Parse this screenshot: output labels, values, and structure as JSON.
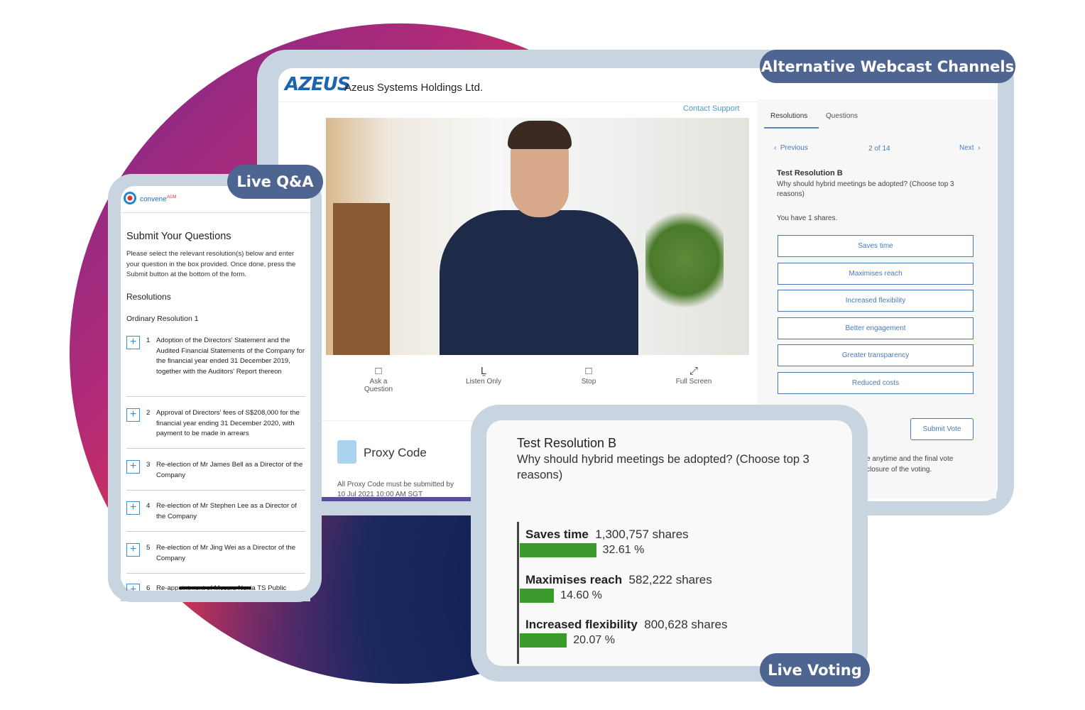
{
  "badges": {
    "webcast": "Alternative Webcast Channels",
    "qa": "Live Q&A",
    "voting": "Live Voting"
  },
  "webcast": {
    "logo_text": "AZEUS",
    "company": "Azeus Systems Holdings Ltd.",
    "contact": "Contact Support",
    "controls": [
      {
        "icon": "ask-question-icon",
        "label": "Ask a Question"
      },
      {
        "icon": "headphones-icon",
        "label": "Listen Only"
      },
      {
        "icon": "stop-icon",
        "label": "Stop"
      },
      {
        "icon": "fullscreen-icon",
        "label": "Full Screen"
      }
    ],
    "proxy": {
      "title": "Proxy Code",
      "text": "All Proxy Code must be submitted by",
      "date": "10 Jul 2021 10:00 AM SGT"
    },
    "panel": {
      "tabs": [
        "Resolutions",
        "Questions"
      ],
      "active_tab": "Resolutions",
      "prev": "Previous",
      "page": "2 of 14",
      "next": "Next",
      "title": "Test Resolution B",
      "question": "Why should hybrid meetings be adopted? (Choose top 3 reasons)",
      "shares": "You have 1 shares.",
      "options": [
        "Saves time",
        "Maximises reach",
        "Increased flexibility",
        "Better engagement",
        "Greater transparency",
        "Reduced costs"
      ],
      "submit": "Submit Vote",
      "note1": "e anytime and the final vote",
      "note2": "closure of the voting."
    }
  },
  "qa": {
    "brand": "convene",
    "brand_sup": "AGM",
    "title": "Submit Your Questions",
    "intro": "Please select the relevant resolution(s) below and enter your question in the box provided. Once done, press the Submit button at the bottom of the form.",
    "section": "Resolutions",
    "group": "Ordinary Resolution 1",
    "items": [
      {
        "n": "1",
        "text": "Adoption of the Directors' Statement and the Audited Financial Statements of the Company for the financial year ended 31 December 2019, together with the Auditors' Report thereon"
      },
      {
        "n": "2",
        "text": "Approval of Directors' fees of S$208,000 for the financial year ending 31 December 2020, with payment to be made in arrears"
      },
      {
        "n": "3",
        "text": "Re-election of Mr James Bell as a Director of the Company"
      },
      {
        "n": "4",
        "text": "Re-election of Mr Stephen Lee as a Director of the Company"
      },
      {
        "n": "5",
        "text": "Re-election of Mr Jing Wei as a Director of the Company"
      },
      {
        "n": "6",
        "text": "Re-appointment of Messrs Nexia TS Public"
      }
    ]
  },
  "voting": {
    "title": "Test Resolution B",
    "question": "Why should hybrid meetings be adopted? (Choose top 3 reasons)",
    "bar_color": "#3a9a2c",
    "results": [
      {
        "label": "Saves time",
        "shares": "1,300,757 shares",
        "pct_text": "32.61 %",
        "pct": 32.61
      },
      {
        "label": "Maximises reach",
        "shares": "582,222 shares",
        "pct_text": "14.60 %",
        "pct": 14.6
      },
      {
        "label": "Increased flexibility",
        "shares": "800,628 shares",
        "pct_text": "20.07 %",
        "pct": 20.07
      }
    ]
  }
}
